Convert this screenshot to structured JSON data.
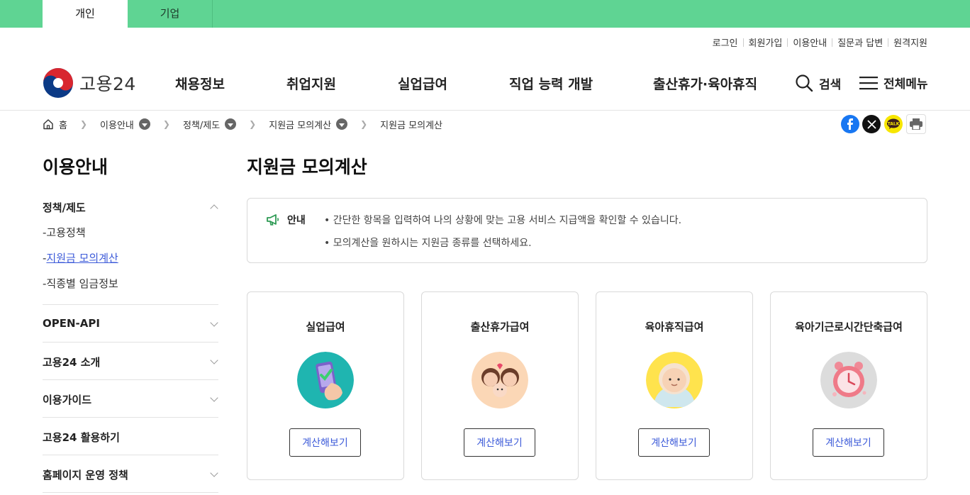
{
  "top_tabs": [
    {
      "label": "개인",
      "active": true
    },
    {
      "label": "기업",
      "active": false
    }
  ],
  "util_links": [
    "로그인",
    "회원가입",
    "이용안내",
    "질문과 답변",
    "원격지원"
  ],
  "logo": {
    "text": "고용24"
  },
  "gnb": [
    "채용정보",
    "취업지원",
    "실업급여",
    "직업 능력 개발",
    "출산휴가·육아휴직"
  ],
  "header_buttons": {
    "search": "검색",
    "menu": "전체메뉴"
  },
  "breadcrumb": [
    "홈",
    "이용안내",
    "정책/제도",
    "지원금 모의계산",
    "지원금 모의계산"
  ],
  "share_icons": [
    "facebook-icon",
    "x-icon",
    "kakaotalk-icon",
    "print-icon"
  ],
  "kakao_badge": "TALK",
  "sidebar": {
    "title": "이용안내",
    "sections": [
      {
        "label": "정책/제도",
        "expanded": true,
        "items": [
          "고용정책",
          "지원금 모의계산",
          "직종별 임금정보"
        ],
        "active_item": "지원금 모의계산"
      },
      {
        "label": "OPEN-API",
        "expanded": false
      },
      {
        "label": "고용24 소개",
        "expanded": false
      },
      {
        "label": "이용가이드",
        "expanded": false
      },
      {
        "label": "고용24 활용하기",
        "expanded": false
      },
      {
        "label": "홈페이지 운영 정책",
        "expanded": false
      }
    ],
    "sub_prefix": "-"
  },
  "main": {
    "title": "지원금 모의계산",
    "notice": {
      "label": "안내",
      "lines": [
        "• 간단한 항목을 입력하여 나의 상황에 맞는 고용 서비스 지급액을 확인할 수 있습니다.",
        "• 모의계산을 원하시는 지원금 종류를 선택하세요."
      ]
    },
    "cards": [
      {
        "title": "실업급여",
        "button": "계산해보기",
        "icon": "phone-check-icon"
      },
      {
        "title": "출산휴가급여",
        "button": "계산해보기",
        "icon": "parents-baby-icon"
      },
      {
        "title": "육아휴직급여",
        "button": "계산해보기",
        "icon": "baby-icon"
      },
      {
        "title": "육아기근로시간단축급여",
        "button": "계산해보기",
        "icon": "alarm-clock-icon"
      }
    ]
  },
  "colors": {
    "top_bar": "#5fd493",
    "link_active": "#3d5bd9",
    "notice_icon": "#2e9a54"
  }
}
